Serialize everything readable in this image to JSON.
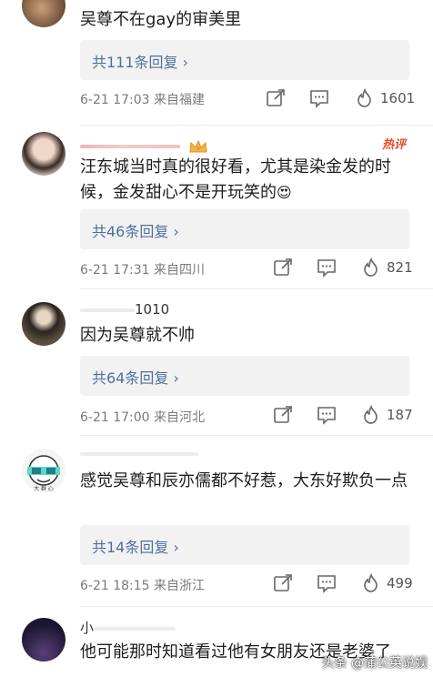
{
  "comments": [
    {
      "user": "",
      "text": "吴尊不在gay的审美里",
      "reply_label": "共111条回复",
      "time": "6-21 17:03",
      "source": "来自福建",
      "likes": "1601"
    },
    {
      "user": "",
      "text": "汪东城当时真的很好看，尤其是染金发的时候，金发甜心不是开玩笑的",
      "badge": "热评",
      "reply_label": "共46条回复",
      "time": "6-21 17:31",
      "source": "来自四川",
      "likes": "821"
    },
    {
      "user": "1010",
      "text": "因为吴尊就不帅",
      "reply_label": "共64条回复",
      "time": "6-21 17:00",
      "source": "来自河北",
      "likes": "187"
    },
    {
      "user": "",
      "text": "感觉吴尊和辰亦儒都不好惹，大东好欺负一点",
      "reply_label": "共14条回复",
      "time": "6-21 18:15",
      "source": "来自浙江",
      "likes": "499"
    },
    {
      "user": "小",
      "text": "他可能那时知道看过他有女朋友还是老婆了"
    }
  ],
  "watermark": "头条 @蒲公英说娱",
  "colors": {
    "link": "#4e6f9d",
    "reply_bg": "#f2f2f2",
    "hot": "#e84b2f"
  }
}
